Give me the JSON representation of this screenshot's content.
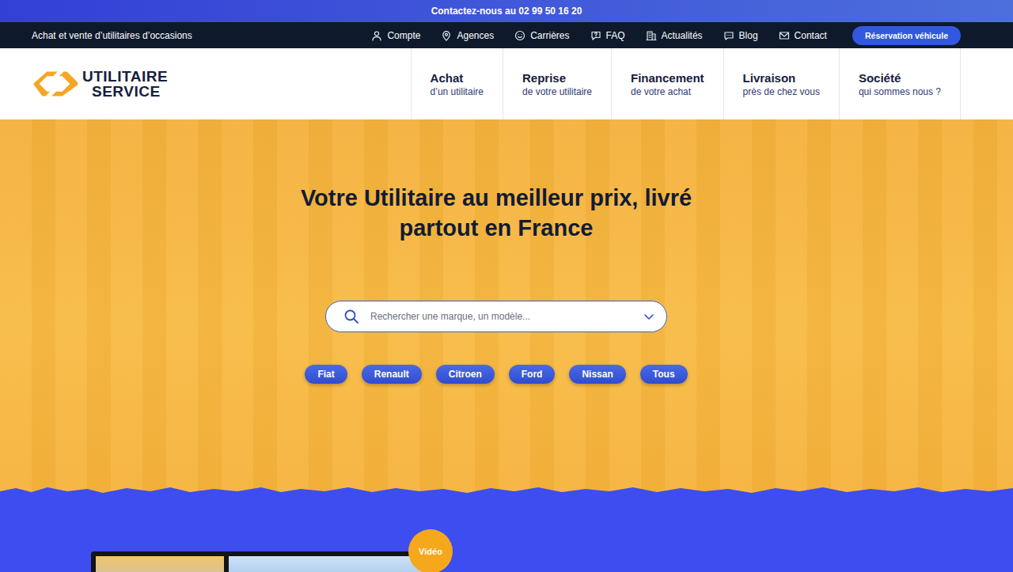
{
  "top_bar": {
    "text": "Contactez-nous au 02 99 50 16 20"
  },
  "utility_bar": {
    "tagline": "Achat et vente d’utilitaires d’occasions",
    "links": [
      "Compte",
      "Agences",
      "Carrières",
      "FAQ",
      "Actualités",
      "Blog",
      "Contact"
    ],
    "button": "Réservation véhicule"
  },
  "header": {
    "logo": {
      "line1": "UTILITAIRE",
      "line2": "SERVICE"
    },
    "menu": [
      {
        "title": "Achat",
        "subtitle": "d’un utilitaire"
      },
      {
        "title": "Reprise",
        "subtitle": "de votre utilitaire"
      },
      {
        "title": "Financement",
        "subtitle": "de votre achat"
      },
      {
        "title": "Livraison",
        "subtitle": "près de chez vous"
      },
      {
        "title": "Société",
        "subtitle": "qui sommes nous ?"
      }
    ]
  },
  "hero": {
    "title_lines": [
      "Votre Utilitaire au meilleur prix, livré",
      "partout en France"
    ],
    "search": {
      "placeholder": "Rechercher une marque, un modèle..."
    },
    "brands": [
      "Fiat",
      "Renault",
      "Citroen",
      "Ford",
      "Nissan",
      "Tous"
    ]
  },
  "video": {
    "badge": "Vidéo"
  }
}
